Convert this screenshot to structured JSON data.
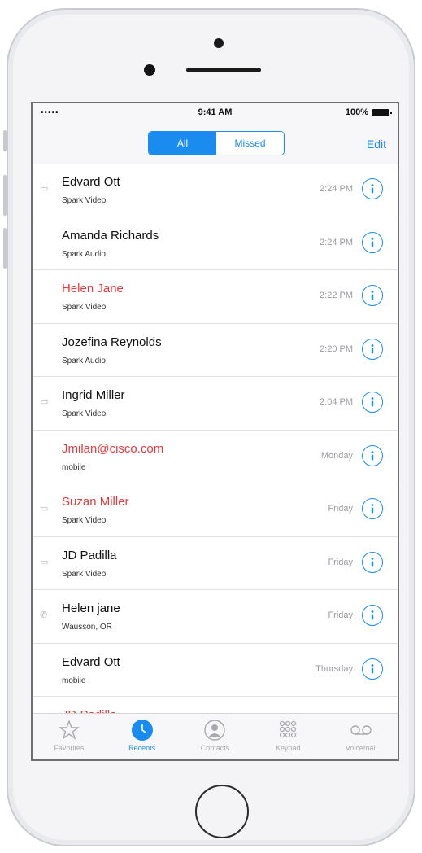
{
  "status_bar": {
    "signal": "•••••",
    "time": "9:41 AM",
    "battery": "100%"
  },
  "segmented_control": {
    "options": [
      "All",
      "Missed"
    ],
    "selected": "All"
  },
  "nav": {
    "edit_label": "Edit"
  },
  "calls": [
    {
      "name": "Edvard Ott",
      "detail": "Spark Video",
      "time": "2:24 PM",
      "missed": false,
      "icon": "video-icon"
    },
    {
      "name": "Amanda Richards",
      "detail": "Spark Audio",
      "time": "2:24 PM",
      "missed": false,
      "icon": ""
    },
    {
      "name": "Helen Jane",
      "detail": "Spark Video",
      "time": "2:22 PM",
      "missed": true,
      "icon": ""
    },
    {
      "name": "Jozefina Reynolds",
      "detail": "Spark Audio",
      "time": "2:20 PM",
      "missed": false,
      "icon": ""
    },
    {
      "name": "Ingrid Miller",
      "detail": "Spark Video",
      "time": "2:04 PM",
      "missed": false,
      "icon": "video-icon"
    },
    {
      "name": "Jmilan@cisco.com",
      "detail": "mobile",
      "time": "Monday",
      "missed": true,
      "icon": ""
    },
    {
      "name": "Suzan Miller",
      "detail": "Spark Video",
      "time": "Friday",
      "missed": true,
      "icon": "video-icon"
    },
    {
      "name": "JD Padilla",
      "detail": "Spark Video",
      "time": "Friday",
      "missed": false,
      "icon": "video-icon"
    },
    {
      "name": "Helen jane",
      "detail": "Wausson, OR",
      "time": "Friday",
      "missed": false,
      "icon": "phone-icon"
    },
    {
      "name": "Edvard Ott",
      "detail": "mobile",
      "time": "Thursday",
      "missed": false,
      "icon": ""
    }
  ],
  "partial_row": {
    "name": "JD Padilla"
  },
  "tabs": [
    {
      "label": "Favorites",
      "icon": "star-icon",
      "active": false
    },
    {
      "label": "Recents",
      "icon": "clock-icon",
      "active": true
    },
    {
      "label": "Contacts",
      "icon": "contact-icon",
      "active": false
    },
    {
      "label": "Keypad",
      "icon": "keypad-icon",
      "active": false
    },
    {
      "label": "Voicemail",
      "icon": "voicemail-icon",
      "active": false
    }
  ],
  "colors": {
    "accent": "#1a8cf0",
    "missed": "#e53b3b"
  }
}
